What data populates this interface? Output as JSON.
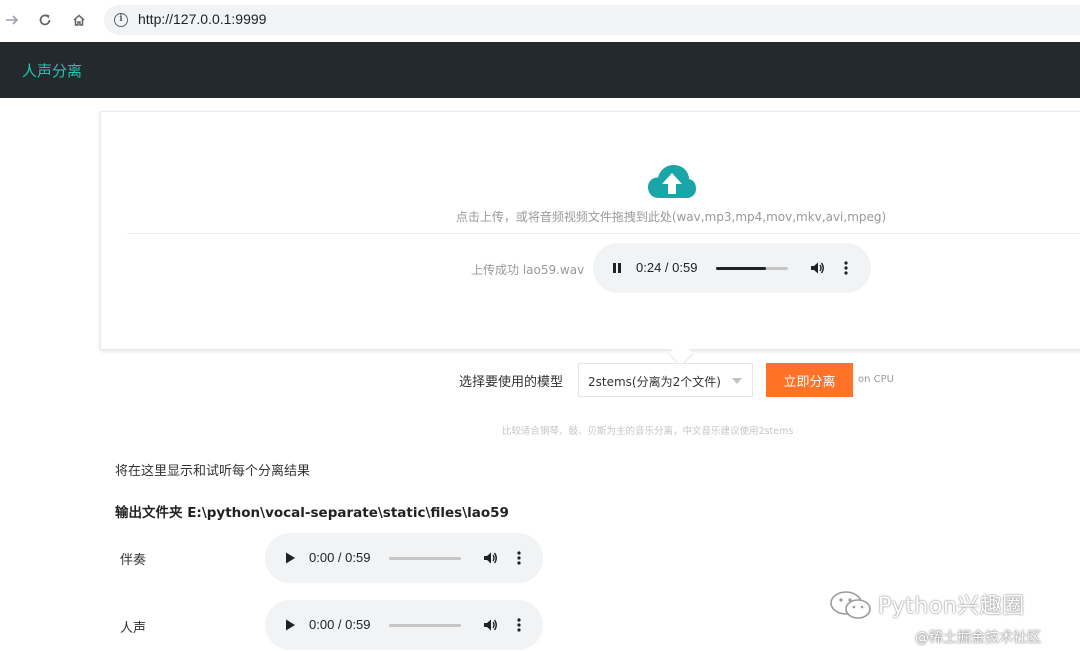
{
  "browser": {
    "back_icon": "arrow-right-icon",
    "reload_icon": "reload-icon",
    "home_icon": "home-icon",
    "info_glyph": "i",
    "url": "http://127.0.0.1:9999"
  },
  "header": {
    "title": "人声分离",
    "title_color": "#1fc5b0",
    "bg_color": "#24292e"
  },
  "upload": {
    "hint": "点击上传，或将音频视频文件拖拽到此处(wav,mp3,mp4,mov,mkv,avi,mpeg)",
    "status": "上传成功 lao59.wav",
    "player": {
      "state": "playing",
      "time": "0:24 / 0:59",
      "progress": 0.7
    }
  },
  "model": {
    "label": "选择要使用的模型",
    "selected": "2stems(分离为2个文件)",
    "button": "立即分离",
    "device_note": "on CPU",
    "description": "比较适合钢琴、鼓、贝斯为主的音乐分离，中文音乐建议使用2stems"
  },
  "results": {
    "hint": "将在这里显示和试听每个分离结果",
    "output_folder": "输出文件夹 E:\\python\\vocal-separate\\static\\files\\lao59",
    "tracks": [
      {
        "label": "伴奏",
        "time": "0:00 / 0:59",
        "progress": 0.0
      },
      {
        "label": "人声",
        "time": "0:00 / 0:59",
        "progress": 0.0
      }
    ]
  },
  "watermark": {
    "primary": "Python兴趣圈",
    "secondary": "@稀土掘金技术社区"
  },
  "colors": {
    "accent": "#ff7227",
    "cloud": "#1aa5a8"
  }
}
